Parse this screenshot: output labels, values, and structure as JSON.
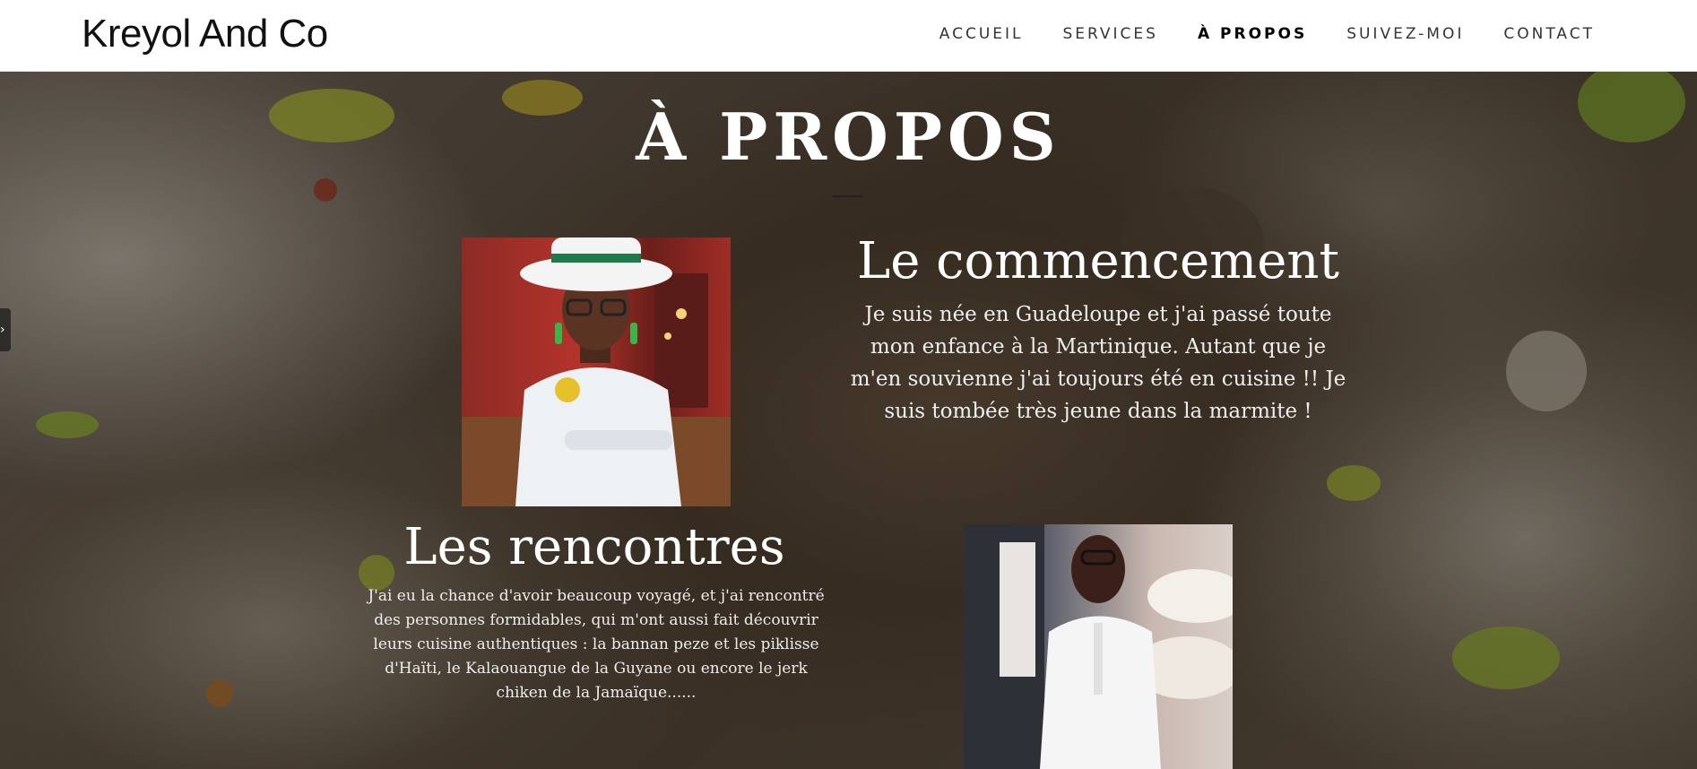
{
  "header": {
    "brand": "Kreyol And Co",
    "nav": [
      {
        "label": "ACCUEIL"
      },
      {
        "label": "SERVICES"
      },
      {
        "label": "À PROPOS"
      },
      {
        "label": "SUIVEZ-MOI"
      },
      {
        "label": "CONTACT"
      }
    ],
    "active_index": 2
  },
  "about": {
    "title": "À PROPOS",
    "blocks": [
      {
        "heading": "Le commencement",
        "text": "Je suis née en Guadeloupe et j'ai passé toute mon enfance à la Martinique. Autant que je m'en souvienne j'ai toujours été en cuisine !! Je suis tombée très jeune dans la marmite !"
      },
      {
        "heading": "Les rencontres",
        "text": "J'ai eu la chance d'avoir beaucoup voyagé, et j'ai rencontré des personnes formidables, qui m'ont aussi fait découvrir leurs cuisine authentiques : la bannan peze et les piklisse d'Haïti, le Kalaouangue de la Guyane ou encore le jerk chiken de la Jamaïque......"
      }
    ]
  },
  "side_tab": {
    "icon": "chevron-right-icon",
    "glyph": "›"
  },
  "colors": {
    "header_bg": "#ffffff",
    "text_light": "#ffffff",
    "rule": "#222222"
  }
}
